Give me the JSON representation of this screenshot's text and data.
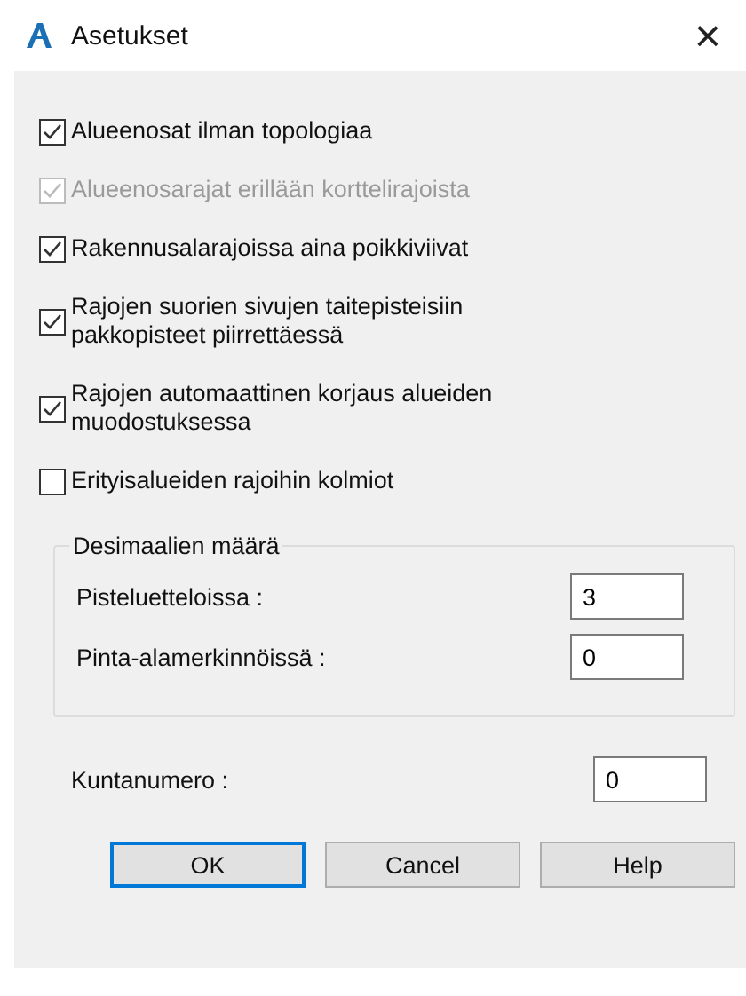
{
  "window": {
    "title": "Asetukset",
    "close": "×"
  },
  "options": [
    {
      "label": "Alueenosat ilman topologiaa",
      "checked": true,
      "disabled": false
    },
    {
      "label": "Alueenosarajat erillään korttelirajoista",
      "checked": true,
      "disabled": true
    },
    {
      "label": "Rakennusalarajoissa aina poikkiviivat",
      "checked": true,
      "disabled": false
    },
    {
      "label": "Rajojen suorien sivujen taitepisteisiin pakkopisteet piirrettäessä",
      "checked": true,
      "disabled": false
    },
    {
      "label": "Rajojen automaattinen korjaus alueiden muodostuksessa",
      "checked": true,
      "disabled": false
    },
    {
      "label": "Erityisalueiden rajoihin kolmiot",
      "checked": false,
      "disabled": false
    }
  ],
  "decimals": {
    "title": "Desimaalien määrä",
    "fields": [
      {
        "label": "Pisteluetteloissa :",
        "value": "3"
      },
      {
        "label": "Pinta-alamerkinnöissä :",
        "value": "0"
      }
    ]
  },
  "municipality": {
    "label": "Kuntanumero :",
    "value": "0"
  },
  "buttons": [
    {
      "label": "OK",
      "default": true
    },
    {
      "label": "Cancel",
      "default": false
    },
    {
      "label": "Help",
      "default": false
    }
  ]
}
